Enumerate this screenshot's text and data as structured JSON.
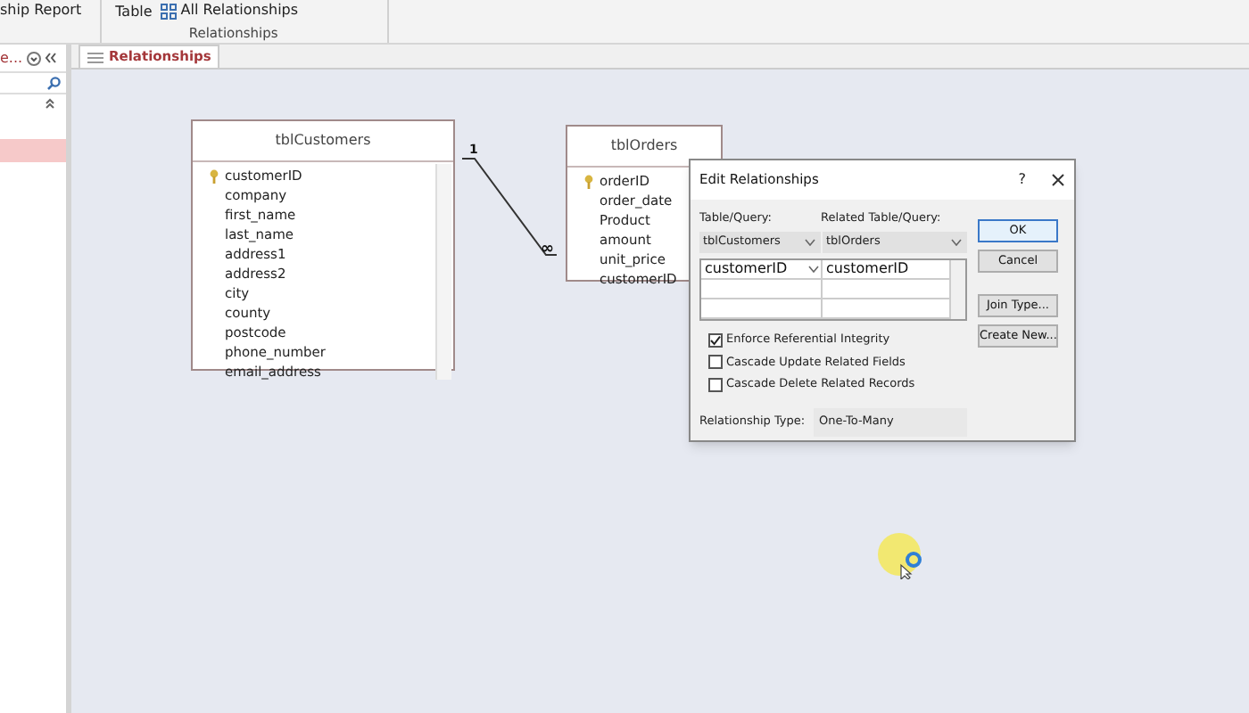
{
  "ribbon": {
    "items": [
      {
        "label": "ship Report"
      },
      {
        "label": "Table"
      },
      {
        "label": "All Relationships"
      }
    ],
    "group_label": "Relationships"
  },
  "nav_pane": {
    "title": "e..."
  },
  "document_tab": {
    "label": "Relationships",
    "selected": true
  },
  "tables": [
    {
      "name": "tblCustomers",
      "fields": [
        {
          "name": "customerID",
          "primary_key": true
        },
        {
          "name": "company",
          "primary_key": false
        },
        {
          "name": "first_name",
          "primary_key": false
        },
        {
          "name": "last_name",
          "primary_key": false
        },
        {
          "name": "address1",
          "primary_key": false
        },
        {
          "name": "address2",
          "primary_key": false
        },
        {
          "name": "city",
          "primary_key": false
        },
        {
          "name": "county",
          "primary_key": false
        },
        {
          "name": "postcode",
          "primary_key": false
        },
        {
          "name": "phone_number",
          "primary_key": false
        },
        {
          "name": "email_address",
          "primary_key": false
        }
      ],
      "scrollbar": true
    },
    {
      "name": "tblOrders",
      "fields": [
        {
          "name": "orderID",
          "primary_key": true
        },
        {
          "name": "order_date",
          "primary_key": false
        },
        {
          "name": "Product",
          "primary_key": false
        },
        {
          "name": "amount",
          "primary_key": false
        },
        {
          "name": "unit_price",
          "primary_key": false
        },
        {
          "name": "customerID",
          "primary_key": false
        }
      ],
      "scrollbar": false
    }
  ],
  "relationship": {
    "one_label": "1",
    "many_label": "∞"
  },
  "dialog": {
    "title": "Edit Relationships",
    "help": "?",
    "table_label": "Table/Query:",
    "related_label": "Related Table/Query:",
    "table_value": "tblCustomers",
    "related_value": "tblOrders",
    "field_rows": [
      {
        "left": "customerID",
        "right": "customerID"
      }
    ],
    "checkboxes": [
      {
        "label": "Enforce Referential Integrity",
        "checked": true
      },
      {
        "label": "Cascade Update Related Fields",
        "checked": false
      },
      {
        "label": "Cascade Delete Related Records",
        "checked": false
      }
    ],
    "type_label": "Relationship Type:",
    "type_value": "One-To-Many",
    "buttons": [
      {
        "label": "OK",
        "selected": true
      },
      {
        "label": "Cancel",
        "selected": false
      },
      {
        "label": "Join Type...",
        "selected": false
      },
      {
        "label": "Create New...",
        "selected": false
      }
    ]
  }
}
